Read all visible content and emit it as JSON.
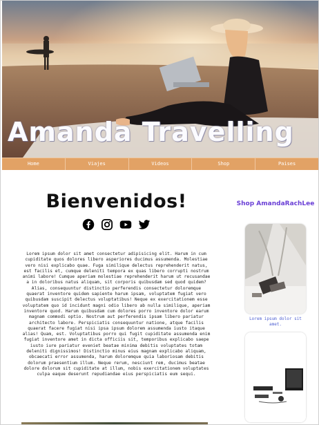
{
  "hero": {
    "title": "Amanda Travelling"
  },
  "nav": {
    "items": [
      "Home",
      "Viajes",
      "Videos",
      "Shop",
      "Paises"
    ]
  },
  "main": {
    "welcome": "Bienvenidos!",
    "socials": [
      "facebook-icon",
      "instagram-icon",
      "youtube-icon",
      "twitter-icon"
    ],
    "body": "Lorem ipsum dolor sit amet consectetur adipisicing elit. Harum in cum cupiditate quos dolores libero asperiores ducimus assumenda. Molestiae vero nisi explicabo quae. Fuga similique delectus reprehenderit natus, est facilis et, cumque deleniti tempora ex quas libero corrupti nostrum animi labore! Cumque aperiam molestiae reprehenderit harum ut recusandae a in doloribus natus aliquam, sit corporis quibusdam sed quod quidem? Alias, consequuntur distinctio perferendis consectetur doloremque quaerat inventore quidem sapiente harum ipsam, voluptatem fugiat vero quibusdam suscipit delectus voluptatibus! Neque ex exercitationem esse voluptatem quo id incidunt magni odio libero ab nulla similique, aperiam inventore quod. Harum quibusdam cum dolores porro inventore dolor earum magnam commodi optio. Nostrum aut perferendis ipsam libero pariatur architecto labore. Perspiciatis consequuntur natione, atque facilis quaerat facere fugiat nisi ipsa ipsum dolorem assumenda iusto itaque alias! Quam, est. Voluptatibus porro qui fugit cupiditate assumenda enim fugiat inventore amet in dicta officiis sit, temporibus explicabo saepe iusto iure pariatur eveniet beatae minima debitis voluptates totam deleniti dignissimos! Distinctio minus eius magnam explicabo aliquam, obcaecati error assumenda, harum doloremque quia laboriosam debitis dolorum praesentium illum. Neque rerum, nesciunt rem, ducimus beatae dolore dolorum sit cupiditate at illum, nobis exercitationem voluptates culpa eaque deserunt repudiandae eius perspiciatis eum sequi."
  },
  "sidebar": {
    "title": "Shop AmandaRachLee",
    "cards": [
      {
        "caption": "Lorem ipsum dolor sit amet."
      },
      {
        "caption": ""
      }
    ]
  }
}
